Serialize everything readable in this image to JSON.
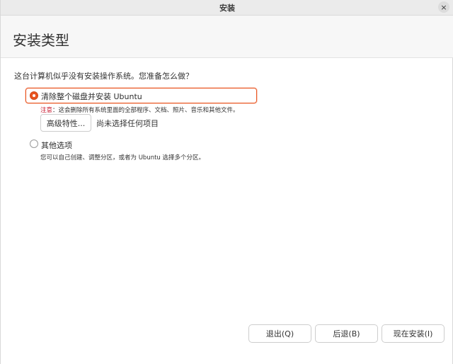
{
  "window": {
    "title": "安装",
    "close_glyph": "×"
  },
  "header": {
    "title": "安装类型"
  },
  "main": {
    "question": "这台计算机似乎没有安装操作系统。您准备怎么做？",
    "options": [
      {
        "label": "清除整个磁盘并安装 Ubuntu",
        "selected": true,
        "warning_label": "注意",
        "warning_text": "：这会删除所有系统里面的全部程序、文档、照片、音乐和其他文件。",
        "advanced_button": "高级特性...",
        "advanced_status": "尚未选择任何项目"
      },
      {
        "label": "其他选项",
        "selected": false,
        "description": "您可以自己创建、调整分区，或者为 Ubuntu 选择多个分区。"
      }
    ]
  },
  "footer": {
    "quit_label": "退出(Q)",
    "back_label": "后退(B)",
    "install_label": "现在安装(I)"
  },
  "colors": {
    "accent": "#e95420",
    "warning": "#c7162b"
  },
  "icons": {
    "close": "close-icon"
  }
}
